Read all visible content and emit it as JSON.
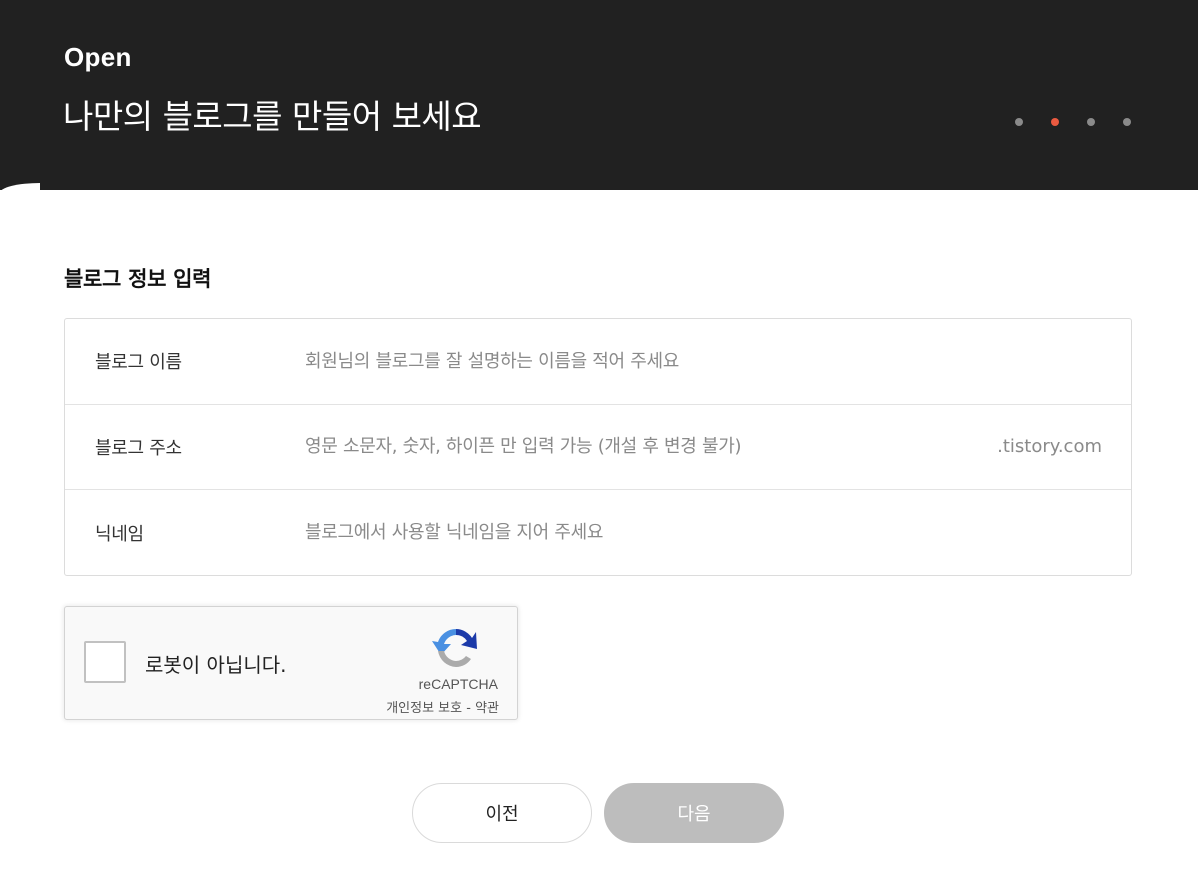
{
  "header": {
    "brand": "Open",
    "headline": "나만의 블로그를 만들어 보세요",
    "steps": {
      "total": 4,
      "current": 2
    }
  },
  "section": {
    "title": "블로그 정보 입력"
  },
  "form": {
    "name": {
      "label": "블로그 이름",
      "value": "",
      "placeholder": "회원님의 블로그를 잘 설명하는 이름을 적어 주세요"
    },
    "address": {
      "label": "블로그 주소",
      "value": "",
      "placeholder": "영문 소문자, 숫자, 하이픈 만 입력 가능 (개설 후 변경 불가)",
      "suffix": ".tistory.com"
    },
    "nickname": {
      "label": "닉네임",
      "value": "",
      "placeholder": "블로그에서 사용할 닉네임을 지어 주세요"
    }
  },
  "recaptcha": {
    "label": "로봇이 아닙니다.",
    "brand": "reCAPTCHA",
    "privacy": "개인정보 보호",
    "separator": "-",
    "terms": "약관",
    "checked": false
  },
  "buttons": {
    "prev": "이전",
    "next": "다음"
  },
  "colors": {
    "header_bg": "#212121",
    "active_step": "#ea5a40",
    "inactive_step": "#8a8a8a",
    "next_button_bg": "#bdbdbd"
  }
}
